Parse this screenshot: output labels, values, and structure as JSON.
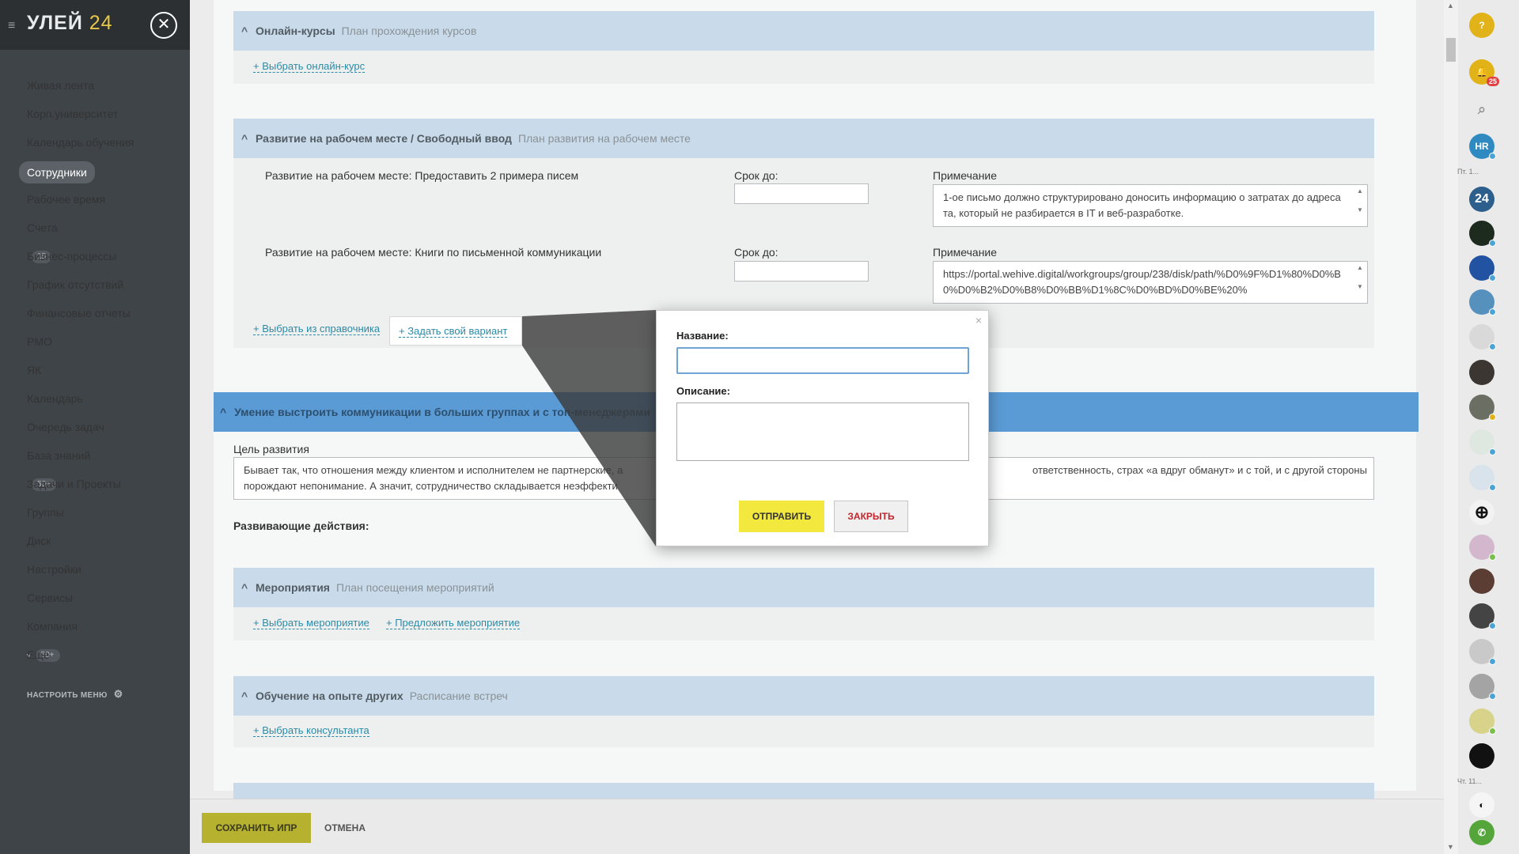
{
  "sidebar": {
    "logo_main": "УЛЕЙ",
    "logo_num": "24",
    "items": [
      {
        "label": "Живая лента",
        "count": ""
      },
      {
        "label": "Корп.университет",
        "count": ""
      },
      {
        "label": "Календарь обучения",
        "count": ""
      },
      {
        "label": "Сотрудники",
        "count": ""
      },
      {
        "label": "Рабочее время",
        "count": ""
      },
      {
        "label": "Счета",
        "count": ""
      },
      {
        "label": "Бизнес-процессы",
        "count": "15"
      },
      {
        "label": "График отсутствий",
        "count": ""
      },
      {
        "label": "Финансовые отчеты",
        "count": ""
      },
      {
        "label": "PMO",
        "count": ""
      },
      {
        "label": "ЯК",
        "count": ""
      },
      {
        "label": "Календарь",
        "count": ""
      },
      {
        "label": "Очередь задач",
        "count": ""
      },
      {
        "label": "База знаний",
        "count": ""
      },
      {
        "label": "Задачи и Проекты",
        "count": "50+"
      },
      {
        "label": "Группы",
        "count": ""
      },
      {
        "label": "Диск",
        "count": ""
      },
      {
        "label": "Настройки",
        "count": ""
      },
      {
        "label": "Сервисы",
        "count": ""
      },
      {
        "label": "Компания",
        "count": ""
      },
      {
        "label": "Еще",
        "count": "50+"
      }
    ],
    "config_label": "НАСТРОИТЬ МЕНЮ"
  },
  "sections": {
    "online": {
      "title": "Онлайн-курсы",
      "subtitle": "План прохождения курсов",
      "link": "+ Выбрать онлайн-курс"
    },
    "workplace": {
      "title": "Развитие на рабочем месте / Свободный ввод",
      "subtitle": "План развития на рабочем месте",
      "rows": [
        {
          "label": "Развитие на рабочем месте: Предоставить 2 примера писем",
          "deadline_label": "Срок до:",
          "note_label": "Примечание",
          "note": "1-ое письмо должно структурировано доносить информацию о затратах до адресата, который не разбирается в IT  и веб-разработке."
        },
        {
          "label": "Развитие на рабочем месте: Книги по письменной коммуникации",
          "deadline_label": "Срок до:",
          "note_label": "Примечание",
          "note": "https://portal.wehive.digital/workgroups/group/238/disk/path/%D0%9F%D1%80%D0%B0%D0%B2%D0%B8%D0%BB%D1%8C%D0%BD%D0%BE%20%"
        }
      ],
      "link_directory": "+ Выбрать из справочника",
      "link_custom": "+ Задать свой вариант"
    },
    "topic": {
      "title": "Умение выстроить коммуникации в больших группах и с топ-менеджерами",
      "goal_label": "Цель развития",
      "goal_text_left": "Бывает так, что отношения между клиентом и исполнителем не партнерские, а",
      "goal_text_left2": "порождают непонимание. А значит, сотрудничество складывается неэффекти",
      "goal_text_right": "ответственность, страх «а вдруг обманут» и с той, и с другой стороны",
      "actions_label": "Развивающие действия:"
    },
    "events": {
      "title": "Мероприятия",
      "subtitle": "План посещения мероприятий",
      "link1": "+ Выбрать мероприятие",
      "link2": "+ Предложить мероприятие"
    },
    "experience": {
      "title": "Обучение на опыте других",
      "subtitle": "Расписание встреч",
      "link": "+ Выбрать консультанта"
    }
  },
  "bottom": {
    "save": "СОХРАНИТЬ ИПР",
    "cancel": "ОТМЕНА"
  },
  "modal": {
    "name_label": "Название:",
    "desc_label": "Описание:",
    "send": "ОТПРАВИТЬ",
    "close": "ЗАКРЫТЬ",
    "close_x": "×"
  },
  "rightbar": {
    "help": "?",
    "notif_count": "25",
    "hr_label": "HR",
    "b24_label": "24",
    "date1": "Пт. 1...",
    "date2": "Чт. 11..."
  }
}
